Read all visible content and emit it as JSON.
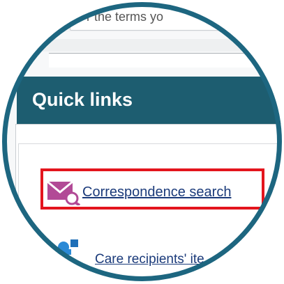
{
  "search": {
    "visible_text": "r the terms yo"
  },
  "quick_links": {
    "title": "Quick links",
    "items": [
      {
        "label": "Correspondence search",
        "icon": "mail-search-icon",
        "highlighted": true
      },
      {
        "label": "Care recipients' ite",
        "icon": "people-icon",
        "highlighted": false
      }
    ]
  },
  "colors": {
    "frame_ring": "#1d6680",
    "header_bg": "#1d5d70",
    "highlight_border": "#e3151d",
    "link_text": "#1a3a7a",
    "icon_magenta": "#b24a96"
  }
}
